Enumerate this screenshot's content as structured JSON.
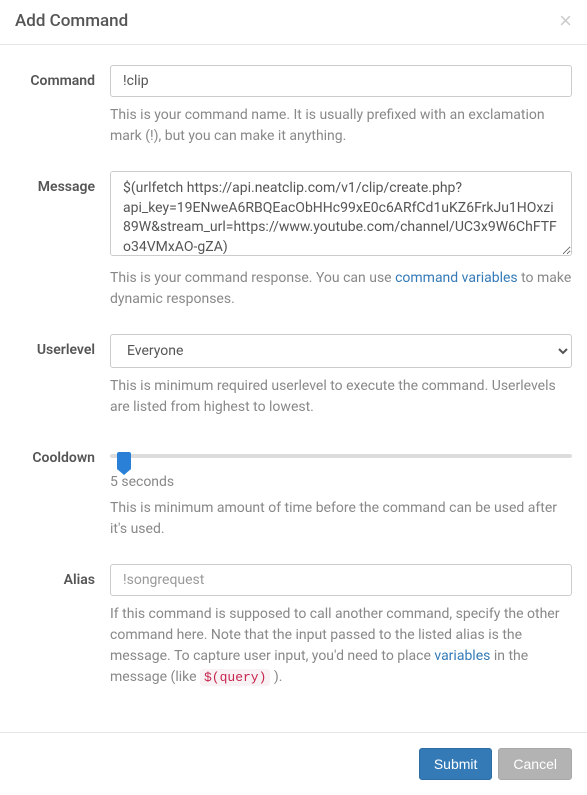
{
  "header": {
    "title": "Add Command"
  },
  "fields": {
    "command": {
      "label": "Command",
      "value": "!clip",
      "help": "This is your command name. It is usually prefixed with an exclamation mark (!), but you can make it anything."
    },
    "message": {
      "label": "Message",
      "value": "$(urlfetch https://api.neatclip.com/v1/clip/create.php?api_key=19ENweA6RBQEacObHHc99xE0c6ARfCd1uKZ6FrkJu1HOxzi89W&stream_url=https://www.youtube.com/channel/UC3x9W6ChFTFo34VMxAO-gZA)",
      "help_before": "This is your command response. You can use ",
      "help_link": "command variables",
      "help_after": " to make dynamic responses."
    },
    "userlevel": {
      "label": "Userlevel",
      "value": "Everyone",
      "help": "This is minimum required userlevel to execute the command. Userlevels are listed from highest to lowest."
    },
    "cooldown": {
      "label": "Cooldown",
      "value_text": "5 seconds",
      "help": "This is minimum amount of time before the command can be used after it's used."
    },
    "alias": {
      "label": "Alias",
      "placeholder": "!songrequest",
      "help_before": "If this command is supposed to call another command, specify the other command here. Note that the input passed to the listed alias is the message. To capture user input, you'd need to place ",
      "help_link": "variables",
      "help_mid": " in the message (like ",
      "help_code": "$(query)",
      "help_after": " )."
    }
  },
  "footer": {
    "submit": "Submit",
    "cancel": "Cancel"
  }
}
